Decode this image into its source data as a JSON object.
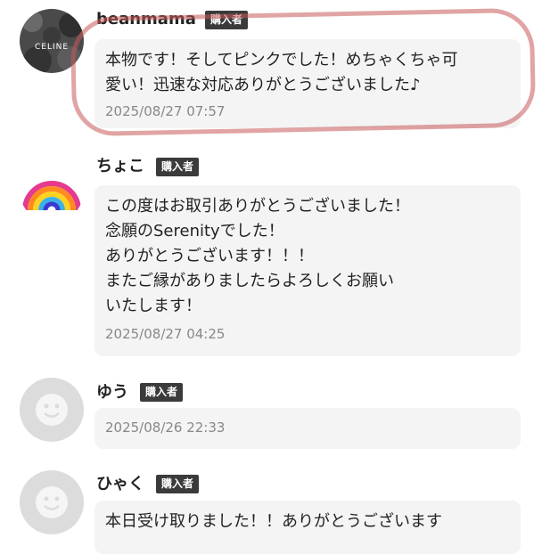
{
  "reviews": [
    {
      "username": "beanmama",
      "badge": "購入者",
      "avatar_icon": "celine-avatar",
      "avatar_text": "CELINE",
      "comment_lines": [
        "本物です！そしてピンクでした！めちゃくちゃ可",
        "愛い！迅速な対応ありがとうございました♪"
      ],
      "date": "2025/08/27 07:57"
    },
    {
      "username": "ちょこ",
      "badge": "購入者",
      "avatar_icon": "rainbow-avatar",
      "comment_lines": [
        "この度はお取引ありがとうございました！",
        "念願のSerenityでした！",
        "ありがとうございます！！！",
        "またご縁がありましたらよろしくお願い",
        "いたします！"
      ],
      "date": "2025/08/27 04:25"
    },
    {
      "username": "ゆう",
      "badge": "購入者",
      "avatar_icon": "default-smiley-avatar",
      "comment_lines": [],
      "date": "2025/08/26 22:33"
    },
    {
      "username": "ひゃく",
      "badge": "購入者",
      "avatar_icon": "default-smiley-avatar",
      "comment_lines": [
        "本日受け取りました！！ありがとうございます"
      ],
      "date": ""
    }
  ],
  "colors": {
    "badge_bg": "#3b3b3b",
    "bubble_bg": "#f4f4f4",
    "highlight": "#c85a5a",
    "date_text": "#888888"
  }
}
